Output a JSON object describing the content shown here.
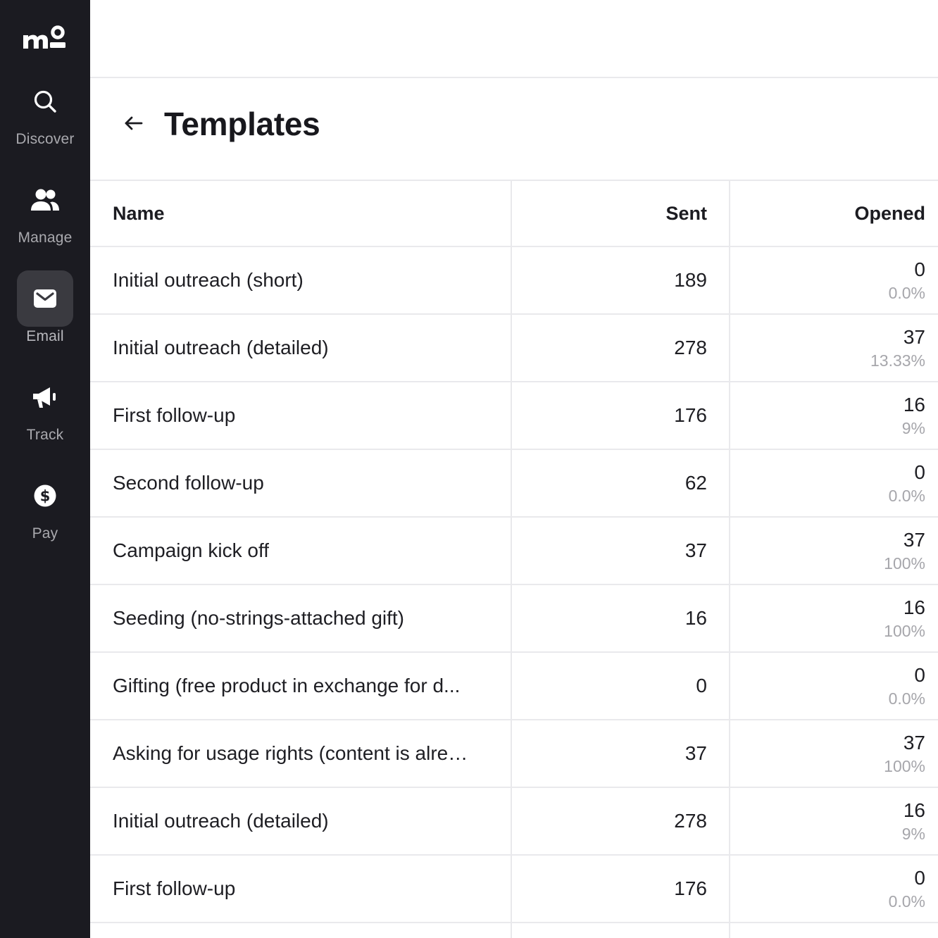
{
  "brand": {
    "logo_text": "mo"
  },
  "sidebar": {
    "items": [
      {
        "label": "Discover",
        "icon": "search-icon"
      },
      {
        "label": "Manage",
        "icon": "users-icon"
      },
      {
        "label": "Email",
        "icon": "envelope-icon",
        "active": true
      },
      {
        "label": "Track",
        "icon": "megaphone-icon"
      },
      {
        "label": "Pay",
        "icon": "dollar-circle-icon"
      }
    ]
  },
  "header": {
    "title": "Templates",
    "back_icon": "arrow-left-icon"
  },
  "table": {
    "columns": {
      "name": "Name",
      "sent": "Sent",
      "opened": "Opened"
    },
    "rows": [
      {
        "name": "Initial outreach (short)",
        "sent": "189",
        "opened": "0",
        "opened_pct": "0.0%"
      },
      {
        "name": "Initial outreach (detailed)",
        "sent": "278",
        "opened": "37",
        "opened_pct": "13.33%"
      },
      {
        "name": "First follow-up",
        "sent": "176",
        "opened": "16",
        "opened_pct": "9%"
      },
      {
        "name": "Second follow-up",
        "sent": "62",
        "opened": "0",
        "opened_pct": "0.0%"
      },
      {
        "name": "Campaign kick off",
        "sent": "37",
        "opened": "37",
        "opened_pct": "100%"
      },
      {
        "name": "Seeding (no-strings-attached gift)",
        "sent": "16",
        "opened": "16",
        "opened_pct": "100%"
      },
      {
        "name": "Gifting (free product in exchange for d...",
        "sent": "0",
        "opened": "0",
        "opened_pct": "0.0%"
      },
      {
        "name": "Asking for usage rights (content is alre…",
        "sent": "37",
        "opened": "37",
        "opened_pct": "100%"
      },
      {
        "name": "Initial outreach (detailed)",
        "sent": "278",
        "opened": "16",
        "opened_pct": "9%"
      },
      {
        "name": "First follow-up",
        "sent": "176",
        "opened": "0",
        "opened_pct": "0.0%"
      }
    ]
  },
  "colors": {
    "sidebar_bg": "#1b1b21",
    "active_bg": "#3a3a40",
    "muted_text": "#a6a6ab",
    "border": "#e9e9ec"
  }
}
